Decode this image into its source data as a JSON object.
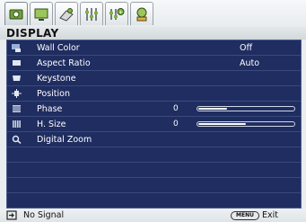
{
  "tabs": [
    {
      "name": "picture-tab",
      "icon": "picture-icon",
      "active": true
    },
    {
      "name": "display-tab",
      "icon": "display-icon",
      "active": false
    },
    {
      "name": "source-tab",
      "icon": "source-icon",
      "active": false
    },
    {
      "name": "settings-tab",
      "icon": "settings-icon",
      "active": false
    },
    {
      "name": "advanced-tab",
      "icon": "advanced-icon",
      "active": false
    },
    {
      "name": "information-tab",
      "icon": "information-icon",
      "active": false
    }
  ],
  "menu": {
    "title": "DISPLAY",
    "items": [
      {
        "icon": "wall-color-icon",
        "label": "Wall Color",
        "value": "Off"
      },
      {
        "icon": "aspect-ratio-icon",
        "label": "Aspect Ratio",
        "value": "Auto"
      },
      {
        "icon": "keystone-icon",
        "label": "Keystone"
      },
      {
        "icon": "position-icon",
        "label": "Position"
      },
      {
        "icon": "phase-icon",
        "label": "Phase",
        "number": "0",
        "level": 0.3
      },
      {
        "icon": "hsize-icon",
        "label": "H. Size",
        "number": "0",
        "level": 0.5
      },
      {
        "icon": "digital-zoom-icon",
        "label": "Digital Zoom"
      }
    ],
    "empty_rows": 4
  },
  "status": {
    "signal_icon": "input-source-icon",
    "signal_text": "No Signal",
    "menu_button": "MENU",
    "exit_text": "Exit"
  },
  "colors": {
    "panel_bg": "#1f2d60",
    "row_divider": "#3a4a7c",
    "text": "#ffffff"
  }
}
